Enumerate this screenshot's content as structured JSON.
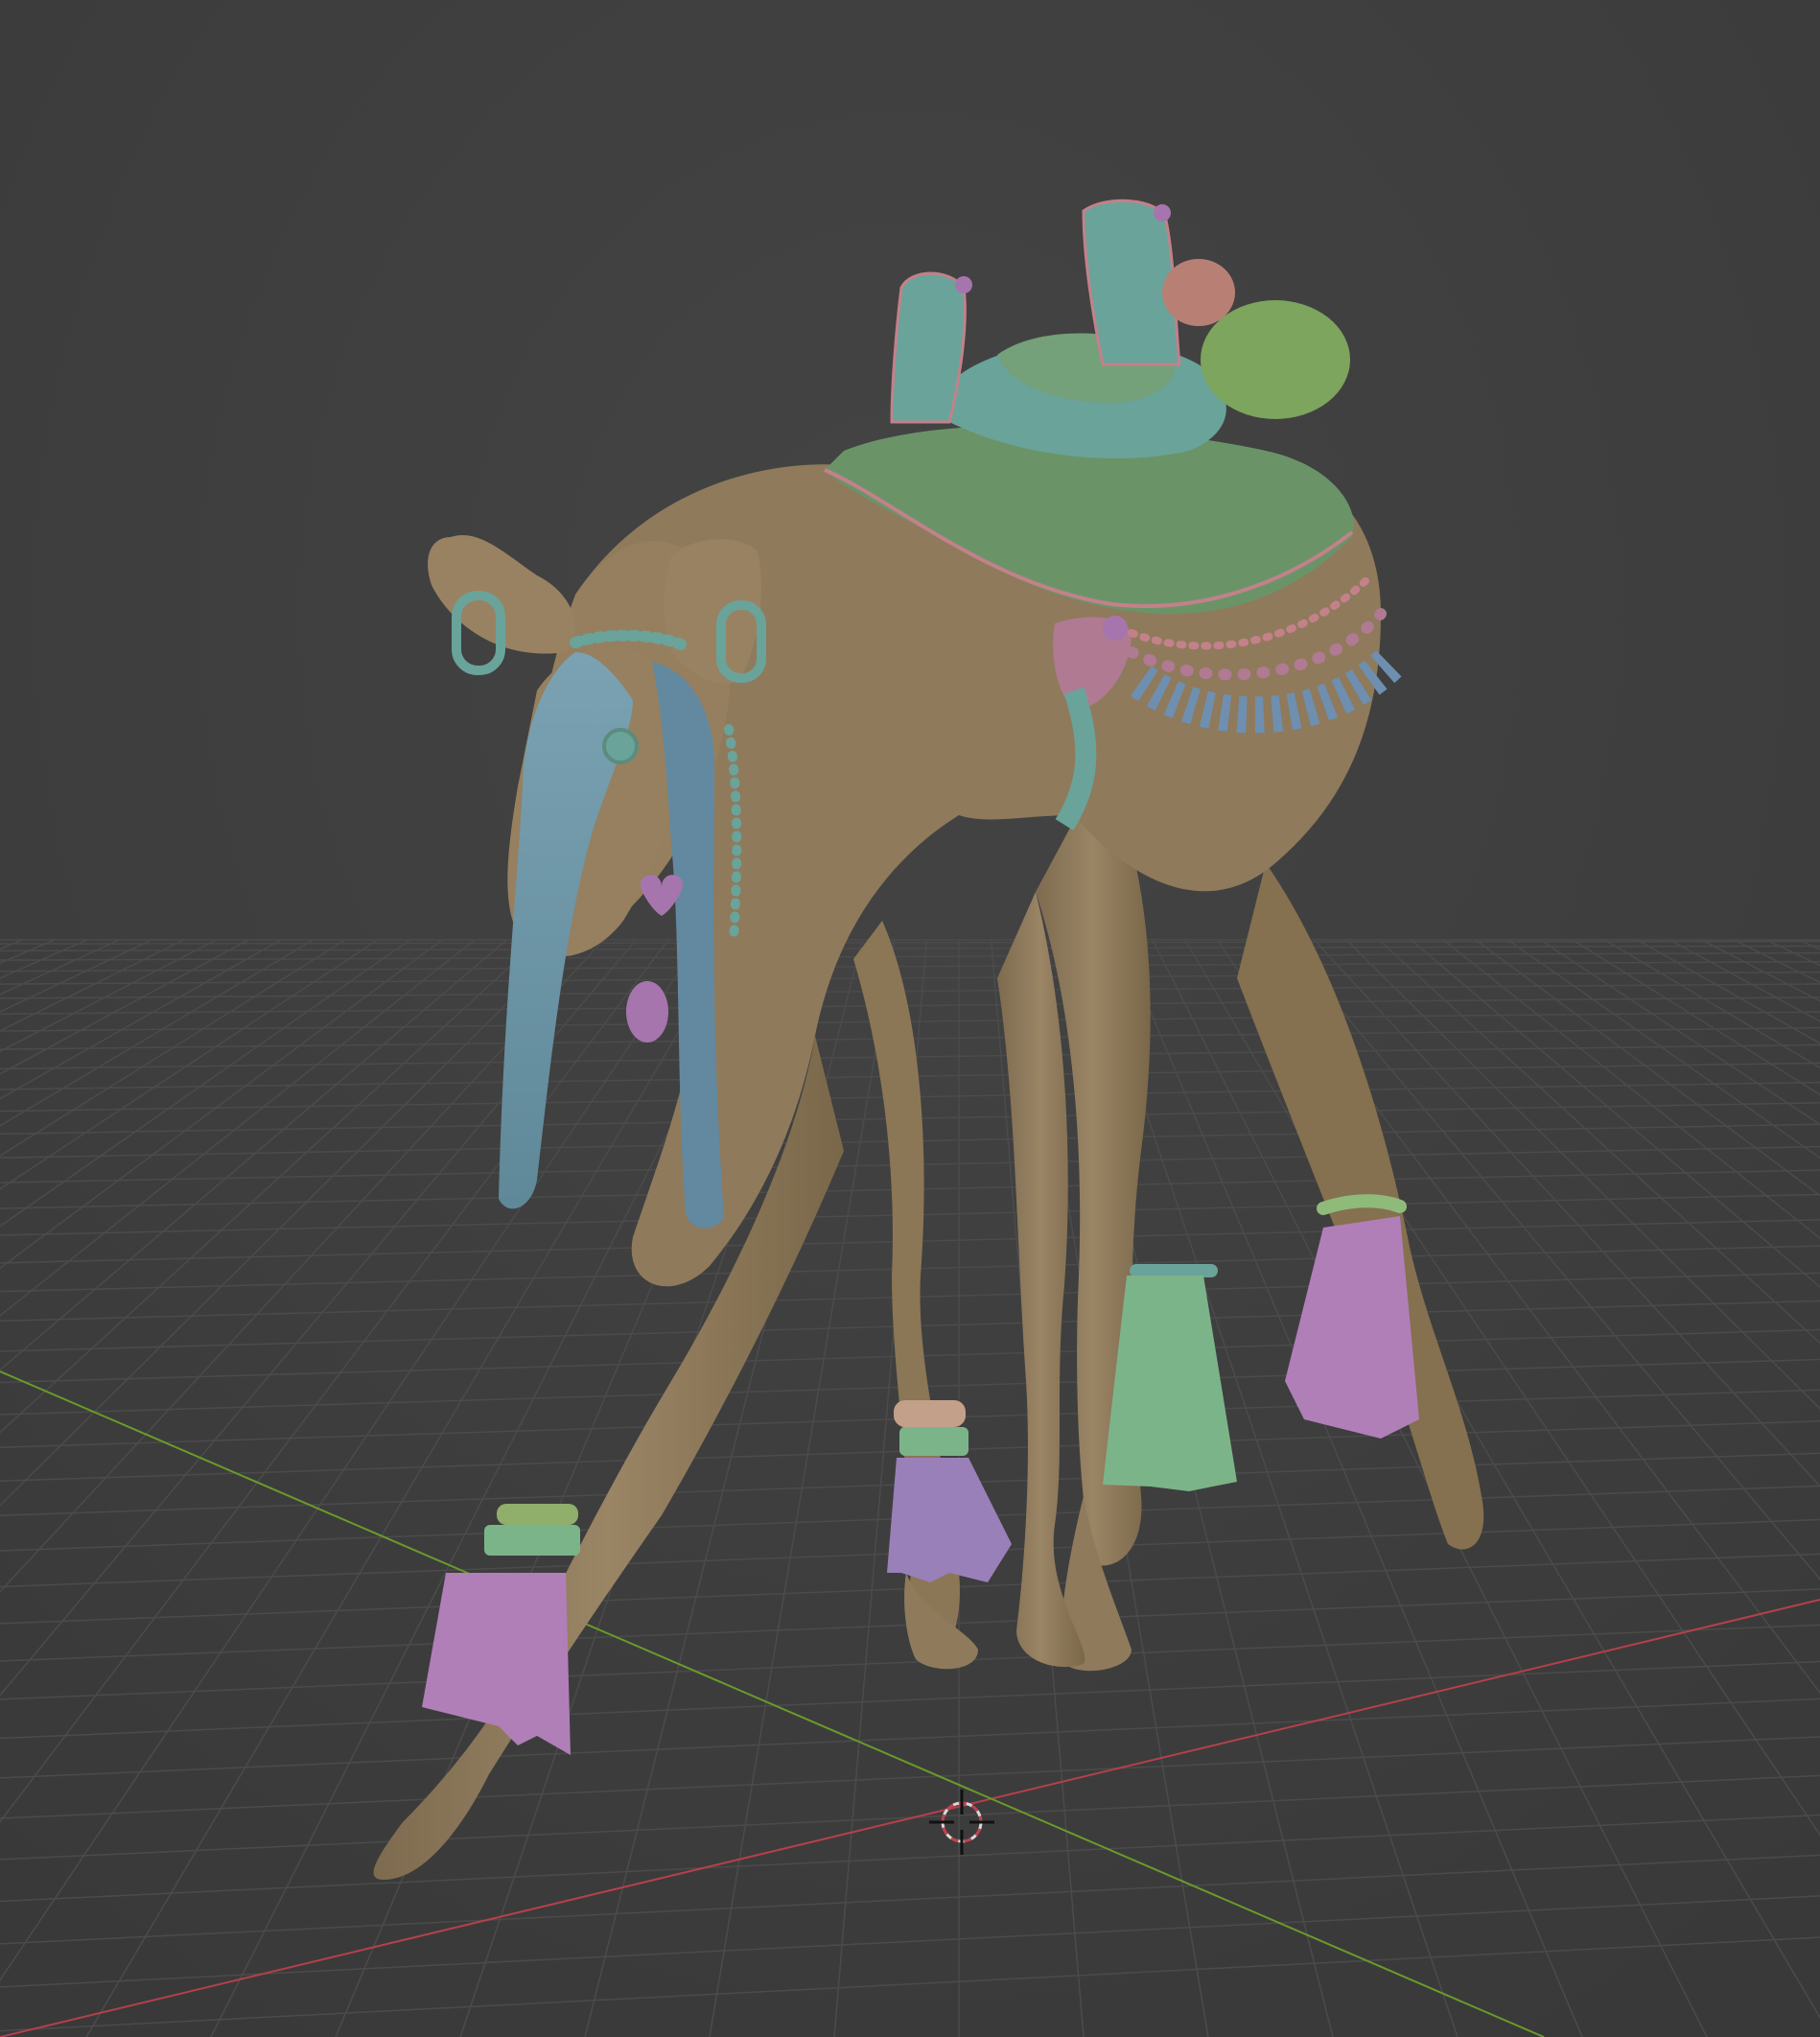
{
  "viewport": {
    "background": "#3d3d3d",
    "grid_color": "#4a4a4a",
    "x_axis_color": "#c0424e",
    "y_axis_color": "#6d9a2a"
  },
  "model": {
    "body_color": "#8f7a5c",
    "body_shade": "#7a6749",
    "saddle_color": "#6a9468",
    "saddle_teal": "#6aa39a",
    "cloth_blue": "#6e97a6",
    "tassel_pink": "#b07fb8",
    "tassel_purple": "#9a80b8",
    "tassel_green": "#7cb48a",
    "bead_pink": "#c3818a",
    "ornament_purple": "#a775ae",
    "cushion_green": "#7da55d",
    "cushion_pink": "#b88075"
  },
  "cursor": {
    "icon": "3d-cursor-icon"
  }
}
